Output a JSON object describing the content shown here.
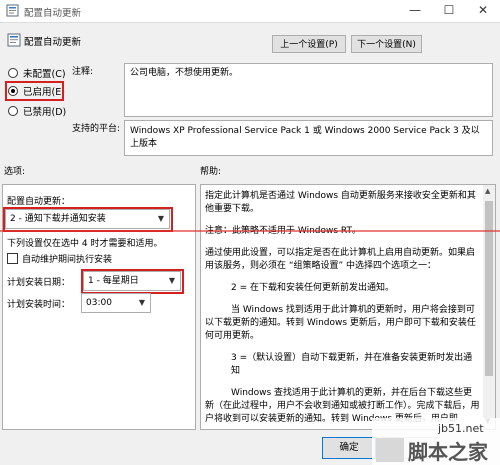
{
  "window": {
    "title": "配置自动更新",
    "minimize_glyph": "—",
    "maximize_glyph": "☐",
    "close_glyph": "✕"
  },
  "header": {
    "title": "配置自动更新",
    "prev_button": "上一个设置(P)",
    "next_button": "下一个设置(N)"
  },
  "state": {
    "options": [
      {
        "label": "未配置(C)",
        "selected": false
      },
      {
        "label": "已启用(E)",
        "selected": true
      },
      {
        "label": "已禁用(D)",
        "selected": false
      }
    ]
  },
  "comment": {
    "label": "注释:",
    "value": "公司电脑，不想使用更新。"
  },
  "supported": {
    "label": "支持的平台:",
    "value": "Windows XP Professional Service Pack 1 或 Windows 2000 Service Pack 3 及以上版本"
  },
  "options_section": {
    "label": "选项:",
    "configure_label": "配置自动更新：",
    "configure_value": "2 - 通知下载并通知安装",
    "note": "下列设置仅在选中 4 时才需要和适用。",
    "maintenance_checkbox": {
      "label": "自动维护期间执行安装",
      "checked": false
    },
    "schedule_day_label": "计划安装日期：",
    "schedule_day_value": "1 - 每星期日",
    "schedule_time_label": "计划安装时间：",
    "schedule_time_value": "03:00"
  },
  "help_section": {
    "label": "帮助:",
    "paragraphs": [
      "指定此计算机是否通过 Windows 自动更新服务来接收安全更新和其他重要下载。",
      "注意：此策略不适用于 Windows RT。",
      "通过使用此设置，可以指定是否在此计算机上启用自动更新。如果启用该服务，则必须在 “组策略设置” 中选择四个选项之一：",
      "2 = 在下载和安装任何更新前发出通知。",
      "当 Windows 找到适用于此计算机的更新时，用户将会接到可以下载更新的通知。转到 Windows 更新后，用户即可下载和安装任何可用更新。",
      "3 =（默认设置）自动下载更新，并在准备安装更新时发出通知",
      "Windows 查找适用于此计算机的更新，并在后台下载这些更新（在此过程中，用户不会收到通知或被打断工作）。完成下载后，用户将收到可以安装更新的通知。转到 Windows 更新后，用户即"
    ]
  },
  "footer": {
    "ok_button": "确定"
  },
  "watermark": {
    "line1": "jb51.net",
    "line2": "脚本之家"
  },
  "colors": {
    "highlight_red": "#d42020",
    "annotation_line": "#e03030",
    "primary_button_border": "#0078d7"
  },
  "icons": [
    "policy-settings-icon",
    "minimize-icon",
    "maximize-icon",
    "close-icon",
    "dropdown-caret-icon",
    "scroll-up-icon",
    "scroll-down-icon"
  ]
}
